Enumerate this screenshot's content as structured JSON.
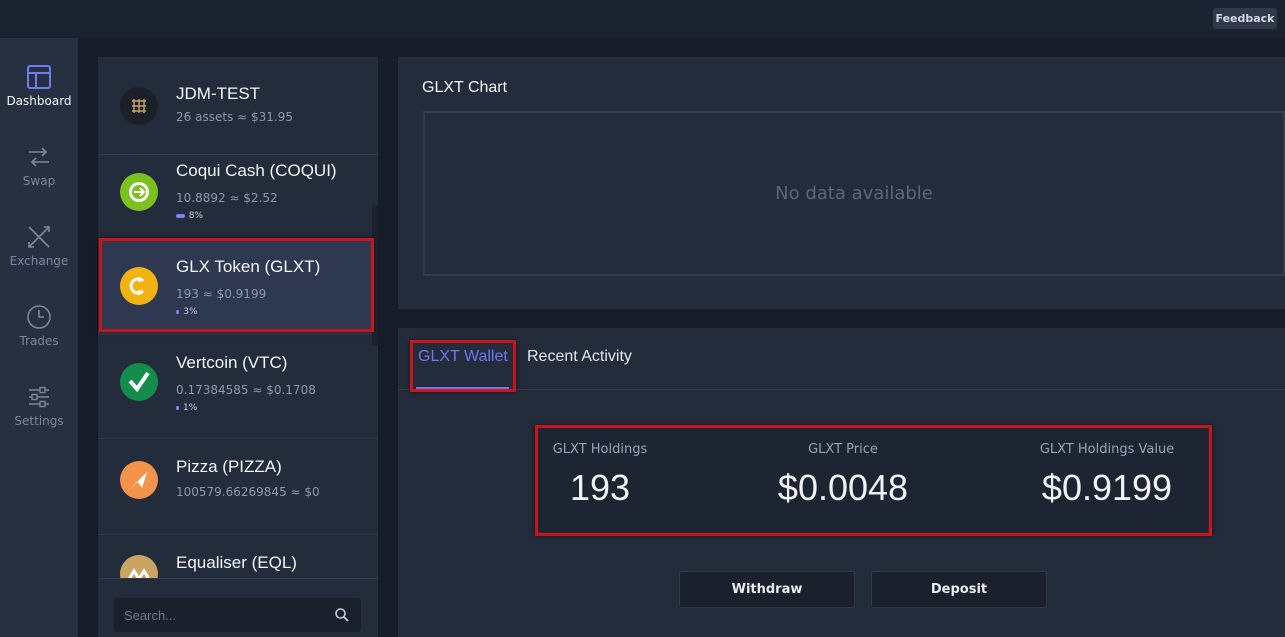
{
  "topbar": {
    "feedback_label": "Feedback"
  },
  "nav": [
    {
      "label": "Dashboard",
      "icon": "dashboard-icon",
      "active": true
    },
    {
      "label": "Swap",
      "icon": "swap-icon",
      "active": false
    },
    {
      "label": "Exchange",
      "icon": "exchange-icon",
      "active": false
    },
    {
      "label": "Trades",
      "icon": "clock-icon",
      "active": false
    },
    {
      "label": "Settings",
      "icon": "sliders-icon",
      "active": false
    }
  ],
  "wallet": {
    "name": "JDM-TEST",
    "summary": "26 assets ≈ $31.95"
  },
  "assets": [
    {
      "name": "Coqui Cash (COQUI)",
      "balance": "10.8892 ≈ $2.52",
      "pct": "8%",
      "pct_value": 8,
      "color": "#7cc21f"
    },
    {
      "name": "GLX Token (GLXT)",
      "balance": "193 ≈ $0.9199",
      "pct": "3%",
      "pct_value": 3,
      "color": "#f2b212"
    },
    {
      "name": "Vertcoin (VTC)",
      "balance": "0.17384585 ≈ $0.1708",
      "pct": "1%",
      "pct_value": 1,
      "color": "#138c4c"
    },
    {
      "name": "Pizza (PIZZA)",
      "balance": "100579.66269845 ≈ $0",
      "color": "#f4934c"
    },
    {
      "name": "Equaliser (EQL)",
      "balance": "",
      "color": "#c9a462"
    }
  ],
  "search": {
    "placeholder": "Search..."
  },
  "chart": {
    "title": "GLXT Chart",
    "empty_text": "No data available"
  },
  "tabs": {
    "wallet": "GLXT Wallet",
    "activity": "Recent Activity"
  },
  "stats": {
    "holdings_label": "GLXT Holdings",
    "holdings_value": "193",
    "price_label": "GLXT Price",
    "price_value": "$0.0048",
    "value_label": "GLXT Holdings Value",
    "value_value": "$0.9199"
  },
  "actions": {
    "withdraw": "Withdraw",
    "deposit": "Deposit"
  },
  "colors": {
    "accent": "#6f78f2",
    "highlight": "#c8161c"
  }
}
